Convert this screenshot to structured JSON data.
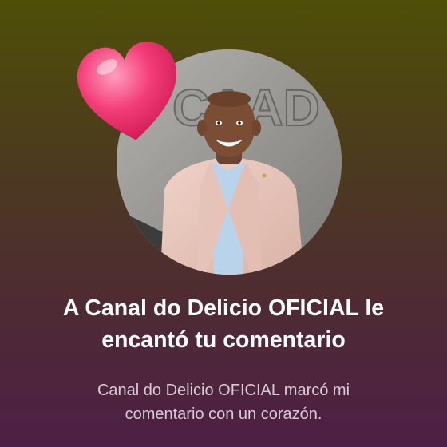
{
  "notification": {
    "avatar_sign_text": "CAAD",
    "heart_icon": "heart-icon",
    "headline_line1": "A Canal do Delicio OFICIAL le",
    "headline_line2": "encantó tu comentario",
    "subtext_line1": "Canal do Delicio OFICIAL marcó mi",
    "subtext_line2": "comentario con un corazón."
  },
  "colors": {
    "background_top": "#4f4f08",
    "background_bottom": "#4d1f46",
    "heart": "#f0326f",
    "headline": "#ffffff",
    "subtext": "#d9ccd5"
  }
}
